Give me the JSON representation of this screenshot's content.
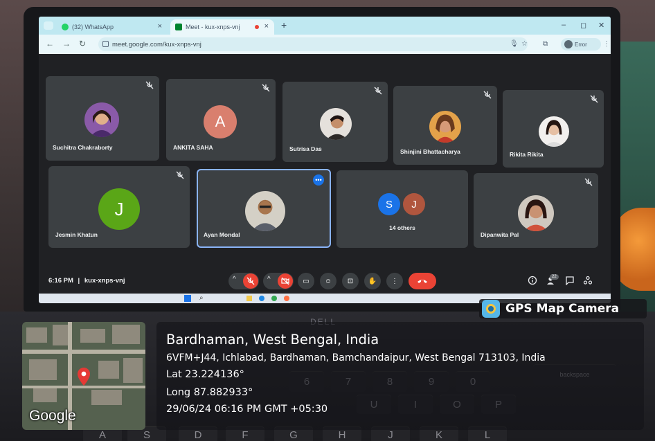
{
  "browser": {
    "tabs": [
      {
        "label": "(32) WhatsApp",
        "active": false
      },
      {
        "label": "Meet - kux-xnps-vnj",
        "active": true
      }
    ],
    "url": "meet.google.com/kux-xnps-vnj",
    "profile_label": "Error"
  },
  "meeting": {
    "participants_row1": [
      {
        "name": "Suchitra Chakraborty",
        "avatar": "photo",
        "muted": true
      },
      {
        "name": "ANKITA SAHA",
        "avatar": "letter",
        "letter": "A",
        "color": "#d97f6e",
        "muted": true
      },
      {
        "name": "Sutrisa Das",
        "avatar": "photo",
        "muted": true
      },
      {
        "name": "Shinjini Bhattacharya",
        "avatar": "photo",
        "muted": true
      },
      {
        "name": "Rikita Rikita",
        "avatar": "photo",
        "muted": true
      }
    ],
    "participants_row2": [
      {
        "name": "Jesmin Khatun",
        "avatar": "letter",
        "letter": "J",
        "color": "#5aa617",
        "muted": true
      },
      {
        "name": "Ayan Mondal",
        "avatar": "photo",
        "muted": false,
        "active_speaker": true
      },
      {
        "name": "14 others",
        "avatar": "group",
        "letters": [
          "S",
          "J"
        ],
        "colors": [
          "#1a73e8",
          "#b0563e"
        ]
      },
      {
        "name": "Dipanwita Pal",
        "avatar": "photo",
        "muted": true
      }
    ],
    "time": "6:16 PM",
    "separator": "|",
    "code": "kux-xnps-vnj",
    "people_count": "22",
    "more_dots": "•••"
  },
  "gps": {
    "brand": "GPS Map Camera",
    "map_label": "Google",
    "title": "Bardhaman, West Bengal, India",
    "address": "6VFM+J44, Ichlabad, Bardhaman, Bamchandaipur, West Bengal 713103, India",
    "lat": "Lat 23.224136°",
    "long": "Long 87.882933°",
    "datetime": "29/06/24 06:16 PM GMT +05:30"
  },
  "keyboard": {
    "keys_row": [
      "6",
      "7",
      "8",
      "9",
      "0",
      "backspace"
    ],
    "keys_row2": [
      "U",
      "I",
      "O",
      "P"
    ],
    "keys_row3": [
      "A",
      "S",
      "D",
      "F",
      "G",
      "H",
      "J",
      "K",
      "L"
    ],
    "brand": "DELL"
  },
  "colors": {
    "meet_bg": "#202124",
    "tile_bg": "#3c4043",
    "end_call": "#ea4335",
    "active_border": "#8ab4f8"
  }
}
